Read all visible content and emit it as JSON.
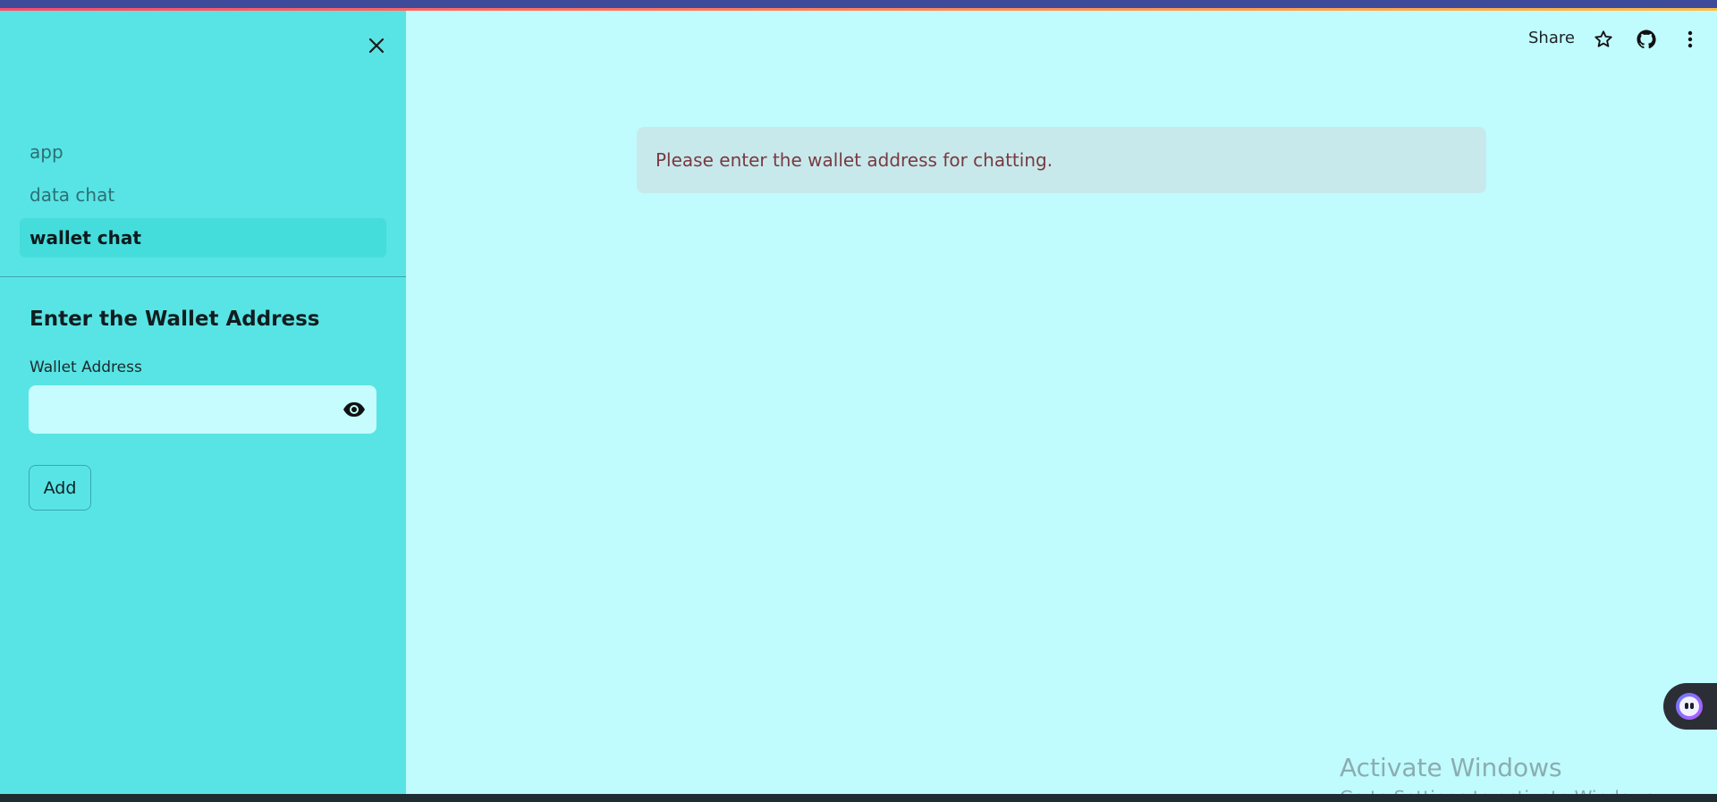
{
  "sidebar": {
    "nav_items": [
      {
        "label": "app",
        "active": false
      },
      {
        "label": "data chat",
        "active": false
      },
      {
        "label": "wallet chat",
        "active": true
      }
    ],
    "section_title": "Enter the Wallet Address",
    "field_label": "Wallet Address",
    "field_value": "",
    "add_button": "Add",
    "icons": {
      "close": "close-icon",
      "eye": "eye-icon"
    }
  },
  "header": {
    "share_label": "Share",
    "icons": [
      "star-icon",
      "github-icon",
      "more-vertical-icon"
    ]
  },
  "main": {
    "alert_text": "Please enter the wallet address for chatting."
  },
  "overlay": {
    "watermark_title": "Activate Windows",
    "watermark_subtitle": "Go to Settings to activate Windows."
  },
  "colors": {
    "sidebar_bg": "#58e4e4",
    "main_bg": "#c0fbfd",
    "alert_bg": "#c8e9ec",
    "alert_text": "#7a3940",
    "active_nav": "#45dcdc"
  }
}
